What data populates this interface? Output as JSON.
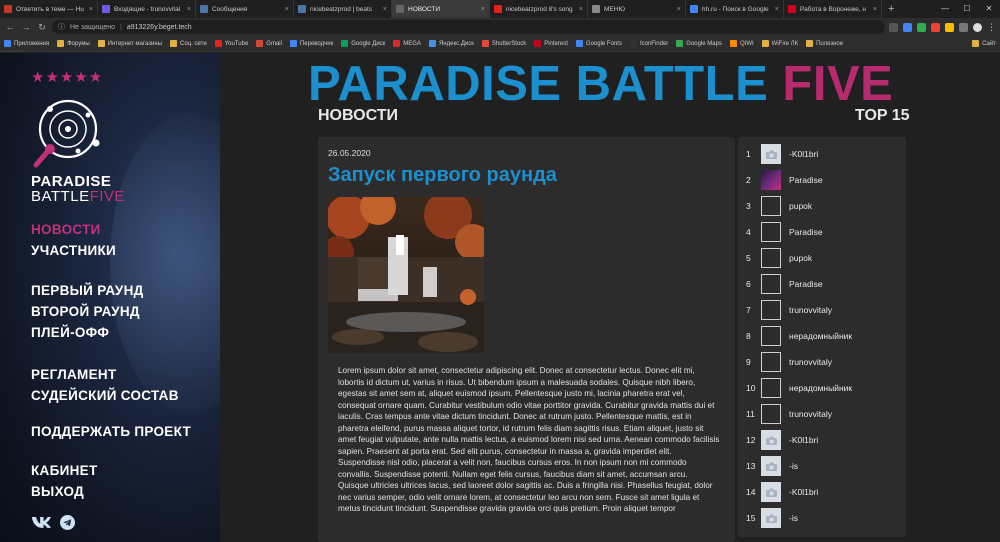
{
  "browser": {
    "tabs": [
      {
        "title": "Ответить в теме — Hu",
        "color": "#c0392b",
        "active": false
      },
      {
        "title": "Входящие - trunovvital",
        "color": "#6c5ce7",
        "active": false
      },
      {
        "title": "Сообщения",
        "color": "#4a76a8",
        "active": false
      },
      {
        "title": "nicebeatzprod | beats",
        "color": "#4a76a8",
        "active": false
      },
      {
        "title": "НОВОСТИ",
        "color": "#666666",
        "active": true
      },
      {
        "title": "nicebeatzprod 8's song",
        "color": "#e62117",
        "active": false
      },
      {
        "title": "МЕНЮ",
        "color": "#888888",
        "active": false
      },
      {
        "title": "hh.ru - Поиск в Google",
        "color": "#4285f4",
        "active": false
      },
      {
        "title": "Работа в Воронеже, н",
        "color": "#d0021b",
        "active": false
      }
    ],
    "newtab": "+",
    "window": {
      "minimize": "—",
      "maximize": "☐",
      "close": "✕"
    },
    "nav": {
      "back": "←",
      "forward": "→",
      "reload": "↻"
    },
    "address": {
      "insecure_label": "Не защищено",
      "separator": "|",
      "url": "a913226y.beget.tech"
    },
    "bookmarks": [
      {
        "label": "Приложения",
        "color": "#4285f4"
      },
      {
        "label": "Форумы",
        "color": "#e0b040"
      },
      {
        "label": "Интернет магазины",
        "color": "#e0b040"
      },
      {
        "label": "Соц. сети",
        "color": "#e0b040"
      },
      {
        "label": "YouTube",
        "color": "#e62117"
      },
      {
        "label": "Gmail",
        "color": "#d44638"
      },
      {
        "label": "Переводчик",
        "color": "#4285f4"
      },
      {
        "label": "Google Диск",
        "color": "#0f9d58"
      },
      {
        "label": "MEGA",
        "color": "#d9272e"
      },
      {
        "label": "Яндекс.Диск",
        "color": "#4a90e2"
      },
      {
        "label": "ShutterStock",
        "color": "#e0493d"
      },
      {
        "label": "Pinterest",
        "color": "#bd081c"
      },
      {
        "label": "Google Fonts",
        "color": "#4285f4"
      },
      {
        "label": "IconFinder",
        "color": "#333333"
      },
      {
        "label": "Google Maps",
        "color": "#34a853"
      },
      {
        "label": "QIWI",
        "color": "#ff8c00"
      },
      {
        "label": "WiFire ЛК",
        "color": "#e0b040"
      },
      {
        "label": "Полезное",
        "color": "#e0b040"
      }
    ],
    "other_bookmarks": {
      "label": "Сайт",
      "color": "#e0b040"
    }
  },
  "site": {
    "stars": "★★★★★",
    "logo_line1": "PARADISE",
    "logo_line2_a": "BATTLE",
    "logo_line2_b": "FIVE",
    "menu": [
      {
        "label": "НОВОСТИ",
        "active": true
      },
      {
        "label": "УЧАСТНИКИ",
        "active": false
      },
      {
        "label": "ПЕРВЫЙ РАУНД",
        "active": false
      },
      {
        "label": "ВТОРОЙ РАУНД",
        "active": false
      },
      {
        "label": "ПЛЕЙ-ОФФ",
        "active": false
      },
      {
        "label": "РЕГЛАМЕНТ",
        "active": false
      },
      {
        "label": "СУДЕЙСКИЙ СОСТАВ",
        "active": false
      },
      {
        "label": "ПОДДЕРЖАТЬ ПРОЕКТ",
        "active": false
      },
      {
        "label": "КАБИНЕТ",
        "active": false
      },
      {
        "label": "ВЫХОД",
        "active": false
      }
    ],
    "header_blue": "PARADISE BATTLE",
    "header_pink": "FIVE",
    "section_news": "НОВОСТИ",
    "section_top": "TOP 15",
    "colors": {
      "accent_blue": "#1c8fcf",
      "accent_pink": "#c2307a"
    }
  },
  "news": {
    "date": "26.05.2020",
    "title": "Запуск первого раунда",
    "body": "Lorem ipsum dolor sit amet, consectetur adipiscing elit. Donec at consectetur lectus. Donec elit mi, lobortis id dictum ut, varius in risus. Ut bibendum ipsum a malesuada sodales. Quisque nibh libero, egestas sit amet sem at, aliquet euismod ipsum. Pellentesque justo mi, lacinia pharetra erat vel, consequat ornare quam. Curabitur vestibulum odio vitae porttitor gravida. Curabitur gravida mattis dui et iaculis. Cras tempus ante vitae dictum tincidunt. Donec at rutrum justo. Pellentesque mattis, est in pharetra eleifend, purus massa aliquet tortor, id rutrum felis diam sagittis risus. Etiam aliquet, justo sit amet feugiat vulputate, ante nulla mattis lectus, a euismod lorem nisi sed urna. Aenean commodo facilisis sapien. Praesent at porta erat. Sed elit purus, consectetur in massa a, gravida imperdiet elit. Suspendisse nisl odio, placerat a velit non, faucibus cursus eros. In non ipsum non mi commodo convallis. Suspendisse potenti. Nullam eget felis cursus, faucibus diam sit amet, accumsan arcu. Quisque ultricies ultrices lacus, sed laoreet dolor sagittis ac. Duis a fringilla nisi. Phasellus feugiat, dolor nec varius semper, odio velit ornare lorem, at consectetur leo arcu non sem. Fusce sit amet ligula et metus tincidunt tincidunt. Suspendisse gravida gravida orci quis pretium. Proin aliquet tempor"
  },
  "top15": [
    {
      "rank": "1",
      "nick": "-K0l1bri",
      "avatar": "camera"
    },
    {
      "rank": "2",
      "nick": "Paradise",
      "avatar": "image"
    },
    {
      "rank": "3",
      "nick": "pupok",
      "avatar": "blank"
    },
    {
      "rank": "4",
      "nick": "Paradise",
      "avatar": "blank"
    },
    {
      "rank": "5",
      "nick": "pupok",
      "avatar": "blank"
    },
    {
      "rank": "6",
      "nick": "Paradise",
      "avatar": "blank"
    },
    {
      "rank": "7",
      "nick": "trunovvitaly",
      "avatar": "blank"
    },
    {
      "rank": "8",
      "nick": "нерадомныйник",
      "avatar": "blank"
    },
    {
      "rank": "9",
      "nick": "trunovvitaly",
      "avatar": "blank"
    },
    {
      "rank": "10",
      "nick": "нерадомныйник",
      "avatar": "blank"
    },
    {
      "rank": "11",
      "nick": "trunovvitaly",
      "avatar": "blank"
    },
    {
      "rank": "12",
      "nick": "-K0l1bri",
      "avatar": "camera"
    },
    {
      "rank": "13",
      "nick": "-is",
      "avatar": "camera"
    },
    {
      "rank": "14",
      "nick": "-K0l1bri",
      "avatar": "camera"
    },
    {
      "rank": "15",
      "nick": "-is",
      "avatar": "camera"
    }
  ]
}
